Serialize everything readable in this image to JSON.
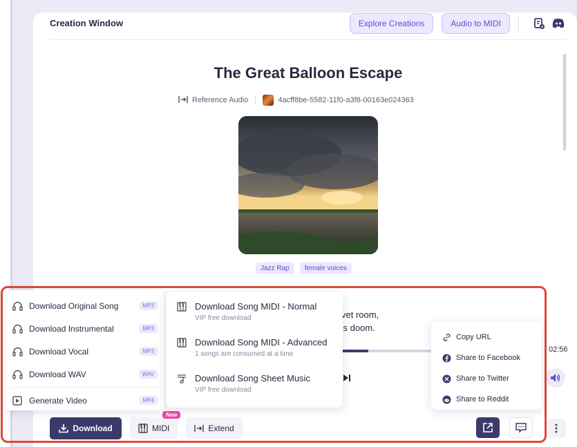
{
  "header": {
    "title": "Creation Window",
    "explore_label": "Explore Creations",
    "audio_midi_label": "Audio to MIDI"
  },
  "song": {
    "title": "The Great Balloon Escape",
    "reference_label": "Reference Audio",
    "reference_id": "4acff8be-5582-11f0-a3f8-00163e024363",
    "tags": [
      "Jazz Rap",
      "female voices"
    ],
    "lyrics_lines": [
      "vet room,",
      "'s doom."
    ],
    "duration": "02:56",
    "progress": 0.3
  },
  "download_menu": {
    "items": [
      {
        "label": "Download Original Song",
        "badge": "MP3"
      },
      {
        "label": "Download Instrumental",
        "badge": "MP3"
      },
      {
        "label": "Download Vocal",
        "badge": "MP3"
      },
      {
        "label": "Download WAV",
        "badge": "WAV"
      }
    ],
    "video": {
      "label": "Generate Video",
      "badge": "MP4"
    }
  },
  "midi_menu": {
    "items": [
      {
        "label": "Download Song MIDI - Normal",
        "sub": "VIP free download"
      },
      {
        "label": "Download Song MIDI - Advanced",
        "sub": "1 songs are consumed at a time"
      },
      {
        "label": "Download Song Sheet Music",
        "sub": "VIP free download"
      }
    ]
  },
  "share_menu": {
    "items": [
      "Copy URL",
      "Share to Facebook",
      "Share to Twitter",
      "Share to Reddit"
    ]
  },
  "bottom": {
    "download_label": "Download",
    "midi_label": "MIDI",
    "new_badge": "New",
    "extend_label": "Extend"
  },
  "colors": {
    "accent": "#5b50c9",
    "primary_dark": "#3c3a6a",
    "highlight_border": "#e0483a",
    "new_badge": "#e945a8"
  }
}
